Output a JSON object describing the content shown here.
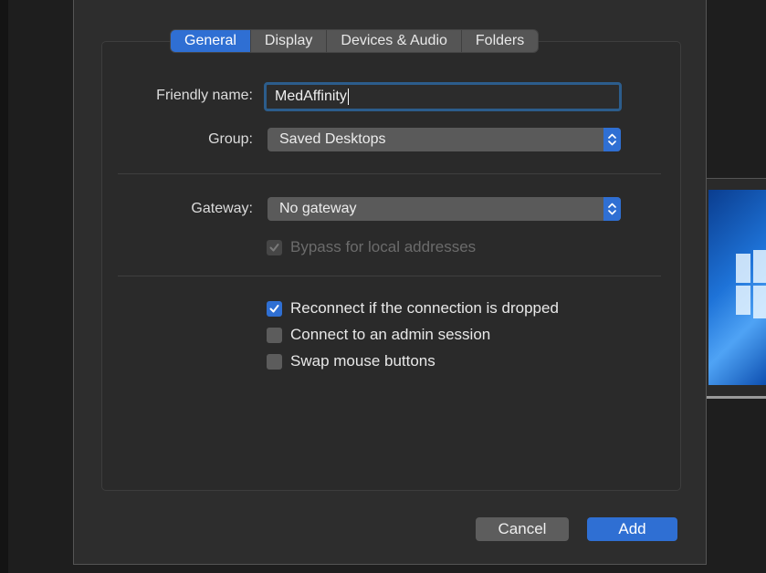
{
  "tabs": [
    "General",
    "Display",
    "Devices & Audio",
    "Folders"
  ],
  "active_tab": "General",
  "form": {
    "friendly_name_label": "Friendly name:",
    "friendly_name_value": "MedAffinity",
    "group_label": "Group:",
    "group_value": "Saved Desktops",
    "gateway_label": "Gateway:",
    "gateway_value": "No gateway"
  },
  "checkboxes": {
    "bypass": {
      "label": "Bypass for local addresses",
      "checked": true,
      "enabled": false
    },
    "reconnect": {
      "label": "Reconnect if the connection is dropped",
      "checked": true,
      "enabled": true
    },
    "admin": {
      "label": "Connect to an admin session",
      "checked": false,
      "enabled": true
    },
    "swap": {
      "label": "Swap mouse buttons",
      "checked": false,
      "enabled": true
    }
  },
  "buttons": {
    "cancel": "Cancel",
    "add": "Add"
  },
  "colors": {
    "accent": "#2f6fd3",
    "sheet_bg": "#2d2d2d",
    "focus_ring": "#2c5d8c"
  }
}
